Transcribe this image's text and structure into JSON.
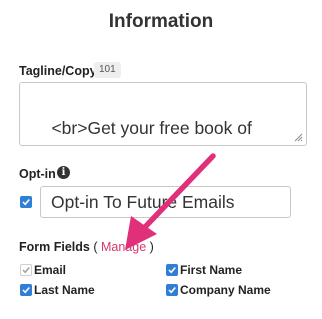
{
  "panel": {
    "title": "Information"
  },
  "tagline": {
    "label": "Tagline/Copy",
    "char_count": "101",
    "value": "<br>Get your free book of\n<b>catchy taglines</b>!"
  },
  "optin": {
    "label": "Opt-in",
    "info_icon": "info-icon",
    "checked": true,
    "value": "Opt-in To Future Emails"
  },
  "form_fields": {
    "label": "Form Fields",
    "paren_open": " (",
    "manage_label": "Manage",
    "paren_close": " )",
    "items": [
      {
        "label": "Email",
        "checked": true,
        "disabled": true
      },
      {
        "label": "First Name",
        "checked": true,
        "disabled": false
      },
      {
        "label": "Last Name",
        "checked": true,
        "disabled": false
      },
      {
        "label": "Company Name",
        "checked": true,
        "disabled": false
      }
    ]
  },
  "colors": {
    "accent": "#2f7fd6",
    "link": "#d43a6b",
    "annotation_arrow": "#e0307a"
  }
}
